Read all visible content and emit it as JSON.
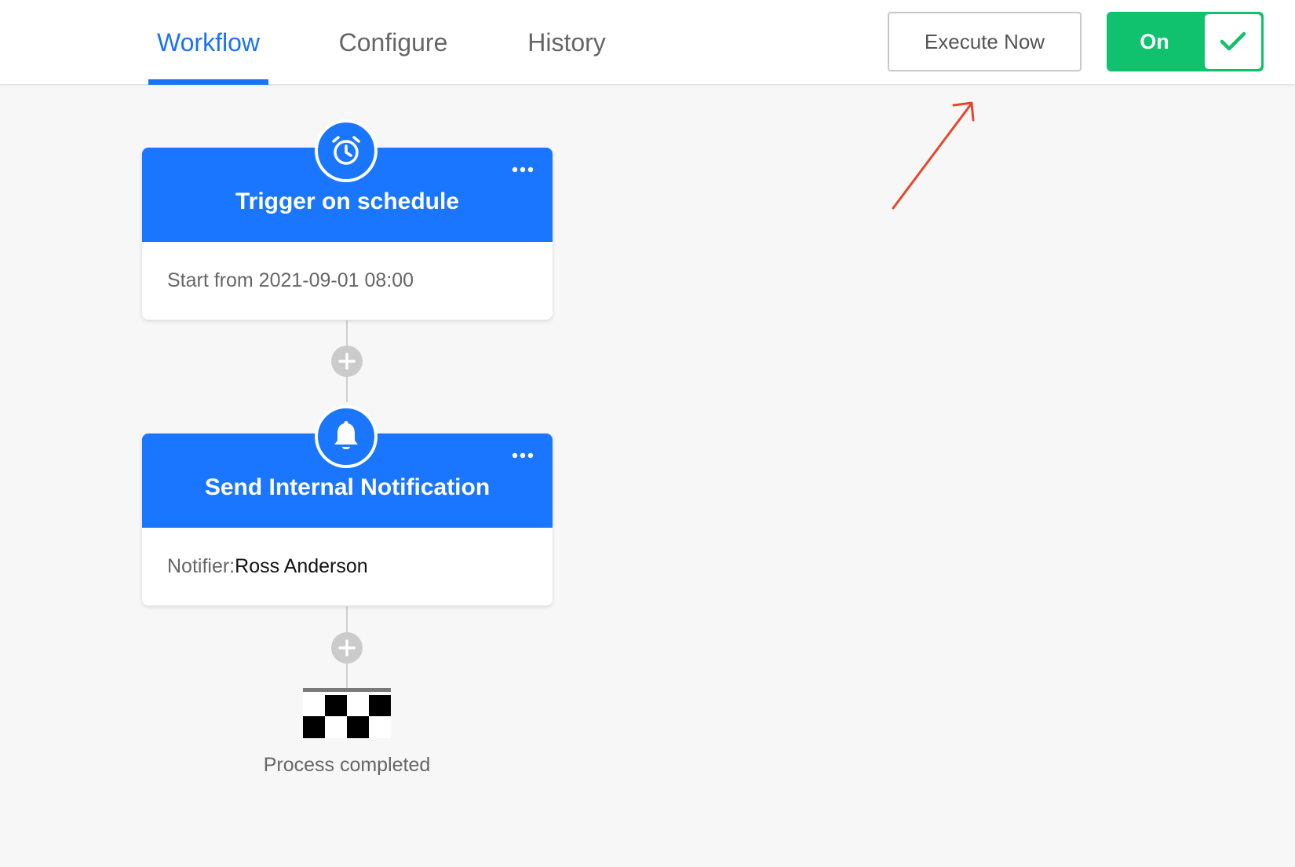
{
  "tabs": [
    {
      "label": "Workflow",
      "active": true
    },
    {
      "label": "Configure",
      "active": false
    },
    {
      "label": "History",
      "active": false
    }
  ],
  "header": {
    "execute_label": "Execute Now",
    "toggle_label": "On",
    "toggle_state": "on"
  },
  "nodes": [
    {
      "icon": "alarm-clock-icon",
      "title": "Trigger on schedule",
      "body_text": "Start from 2021-09-01 08:00"
    },
    {
      "icon": "bell-icon",
      "title": "Send Internal Notification",
      "body_label": "Notifier:",
      "body_value": "Ross Anderson"
    }
  ],
  "finish": {
    "icon": "checkered-flag-icon",
    "label": "Process completed"
  },
  "colors": {
    "accent": "#1a76ff",
    "toggle_on": "#10c16e",
    "annotation_arrow": "#e8452c"
  }
}
